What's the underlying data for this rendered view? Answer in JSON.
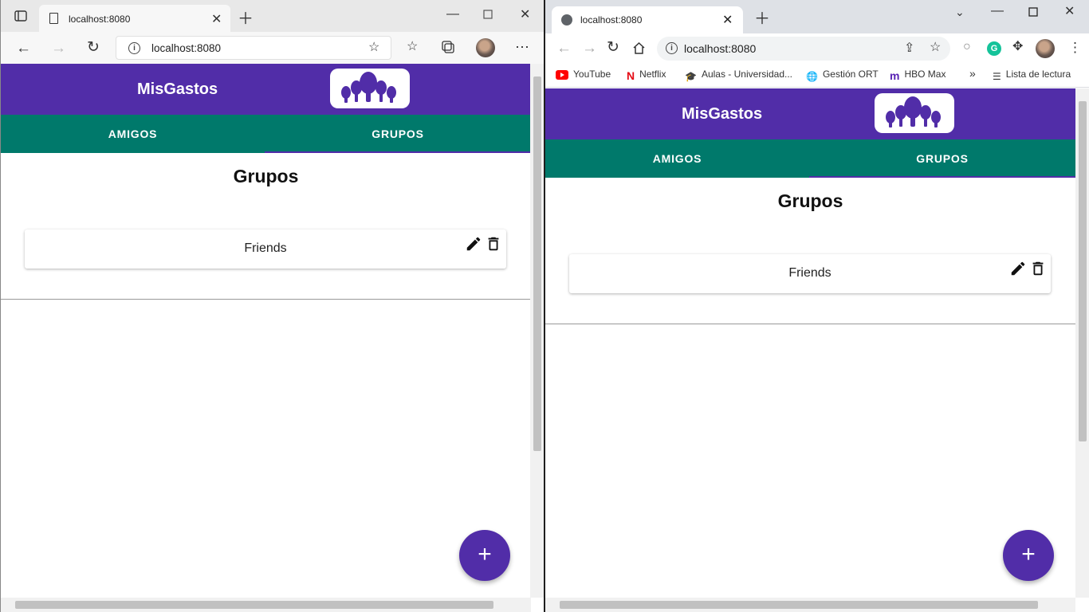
{
  "edge": {
    "tab_title": "localhost:8080",
    "url": "localhost:8080"
  },
  "chrome": {
    "tab_title": "localhost:8080",
    "url": "localhost:8080",
    "bookmarks": [
      "YouTube",
      "Netflix",
      "Aulas - Universidad...",
      "Gestión ORT",
      "HBO Max"
    ],
    "reading_list": "Lista de lectura"
  },
  "app": {
    "title": "MisGastos",
    "tabs": [
      "AMIGOS",
      "GRUPOS"
    ],
    "active_tab": "GRUPOS",
    "page_title": "Grupos",
    "groups": [
      {
        "name": "Friends"
      }
    ],
    "fab_label": "+",
    "colors": {
      "header": "#512da8",
      "tabs": "#00796b",
      "fab": "#512da8"
    }
  }
}
